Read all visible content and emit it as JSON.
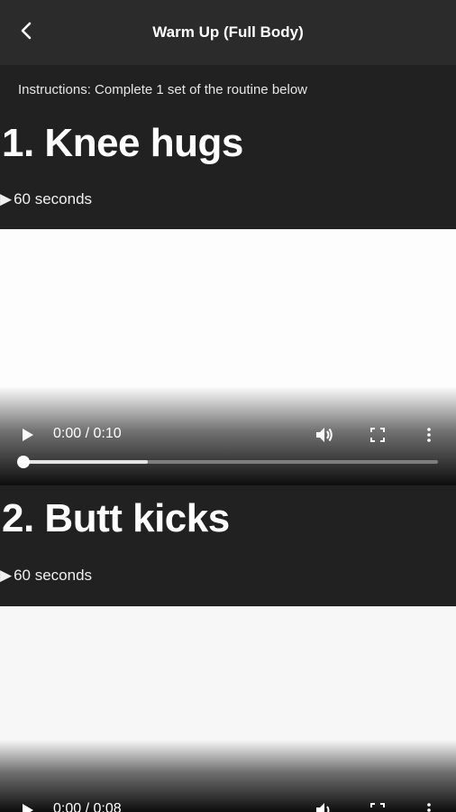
{
  "header": {
    "title": "Warm Up (Full Body)",
    "back_icon": "chevron-left-icon"
  },
  "instructions": "Instructions: Complete 1 set of the routine below",
  "exercises": [
    {
      "title": "1. Knee hugs",
      "duration": "60 seconds",
      "video": {
        "time": "0:00 / 0:10",
        "buffered_fraction": 0.3,
        "played_fraction": 0.0
      }
    },
    {
      "title": "2. Butt kicks",
      "duration": "60 seconds",
      "video": {
        "time": "0:00 / 0:08"
      }
    }
  ],
  "colors": {
    "background": "#212121",
    "header": "#2b2b2b",
    "video": "#fdfdfd",
    "text": "#ffffff"
  }
}
